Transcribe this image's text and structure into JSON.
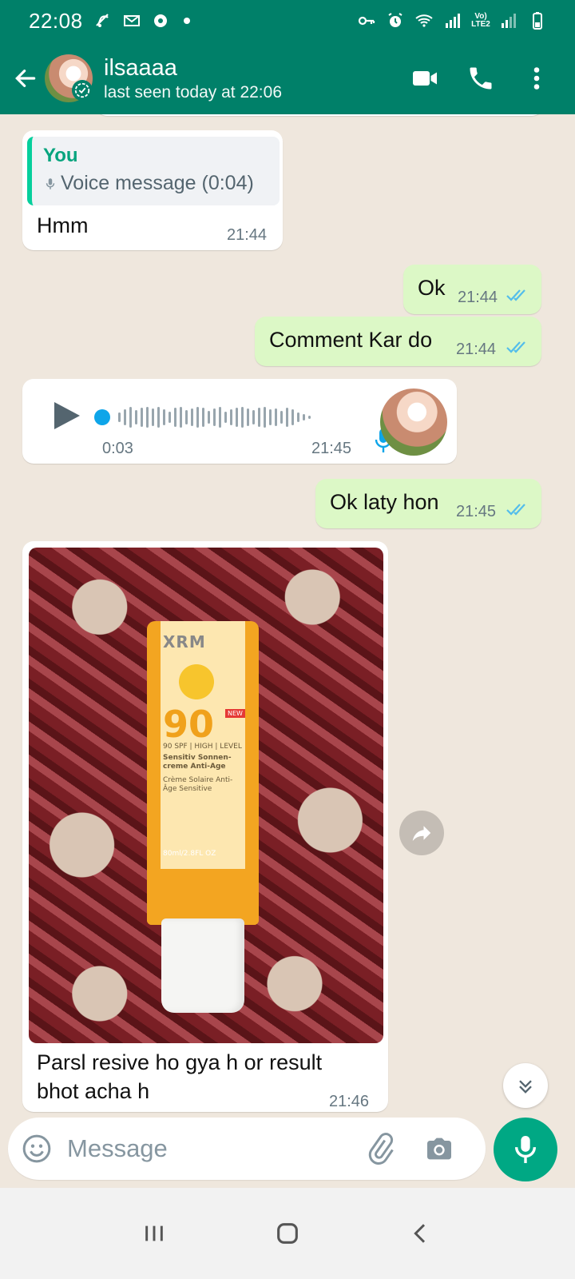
{
  "status_bar": {
    "time": "22:08",
    "left_icons": [
      "muted-notification-icon",
      "gmail-icon",
      "settings-badge-icon",
      "dot-icon"
    ],
    "right_icons": [
      "vpn-key-icon",
      "alarm-icon",
      "wifi-icon",
      "signal-icon",
      "volte-icon",
      "signal2-icon",
      "battery-icon"
    ],
    "volte_text": "Vo)\nLTE2"
  },
  "header": {
    "contact_name": "ilsaaaa",
    "last_seen": "last seen today at 22:06",
    "actions": [
      "video-call-icon",
      "voice-call-icon",
      "more-options-icon"
    ],
    "brand_color": "#008069"
  },
  "messages": [
    {
      "direction": "in",
      "type": "reply",
      "quoted_sender": "You",
      "quoted_text": "Voice message (0:04)",
      "text": "Hmm",
      "time": "21:44"
    },
    {
      "direction": "out",
      "type": "text",
      "text": "Ok",
      "time": "21:44",
      "status": "read"
    },
    {
      "direction": "out",
      "type": "text",
      "text": "Comment Kar do",
      "time": "21:44",
      "status": "read"
    },
    {
      "direction": "in",
      "type": "voice",
      "duration": "0:03",
      "time": "21:45"
    },
    {
      "direction": "out",
      "type": "text",
      "text": "Ok laty hon",
      "time": "21:45",
      "status": "read"
    },
    {
      "direction": "in",
      "type": "image",
      "image_desc": "sunscreen-tube-photo",
      "caption": "Parsl resive ho gya h or result bhot acha h",
      "time": "21:46",
      "product": {
        "brand": "XRM",
        "spf": "90",
        "line1": "90 SPF | HIGH | LEVEL",
        "line2": "Sensitiv Sonnen-creme Anti-Age",
        "line3": "Crème Solaire Anti-Âge Sensitive",
        "volume": "80ml/2.8FL OZ",
        "badge": "NEW"
      }
    }
  ],
  "input": {
    "placeholder": "Message"
  },
  "colors": {
    "outgoing_bubble": "#dcf8c6",
    "incoming_bubble": "#ffffff",
    "tick_read": "#53bdeb",
    "accent": "#00a884"
  }
}
